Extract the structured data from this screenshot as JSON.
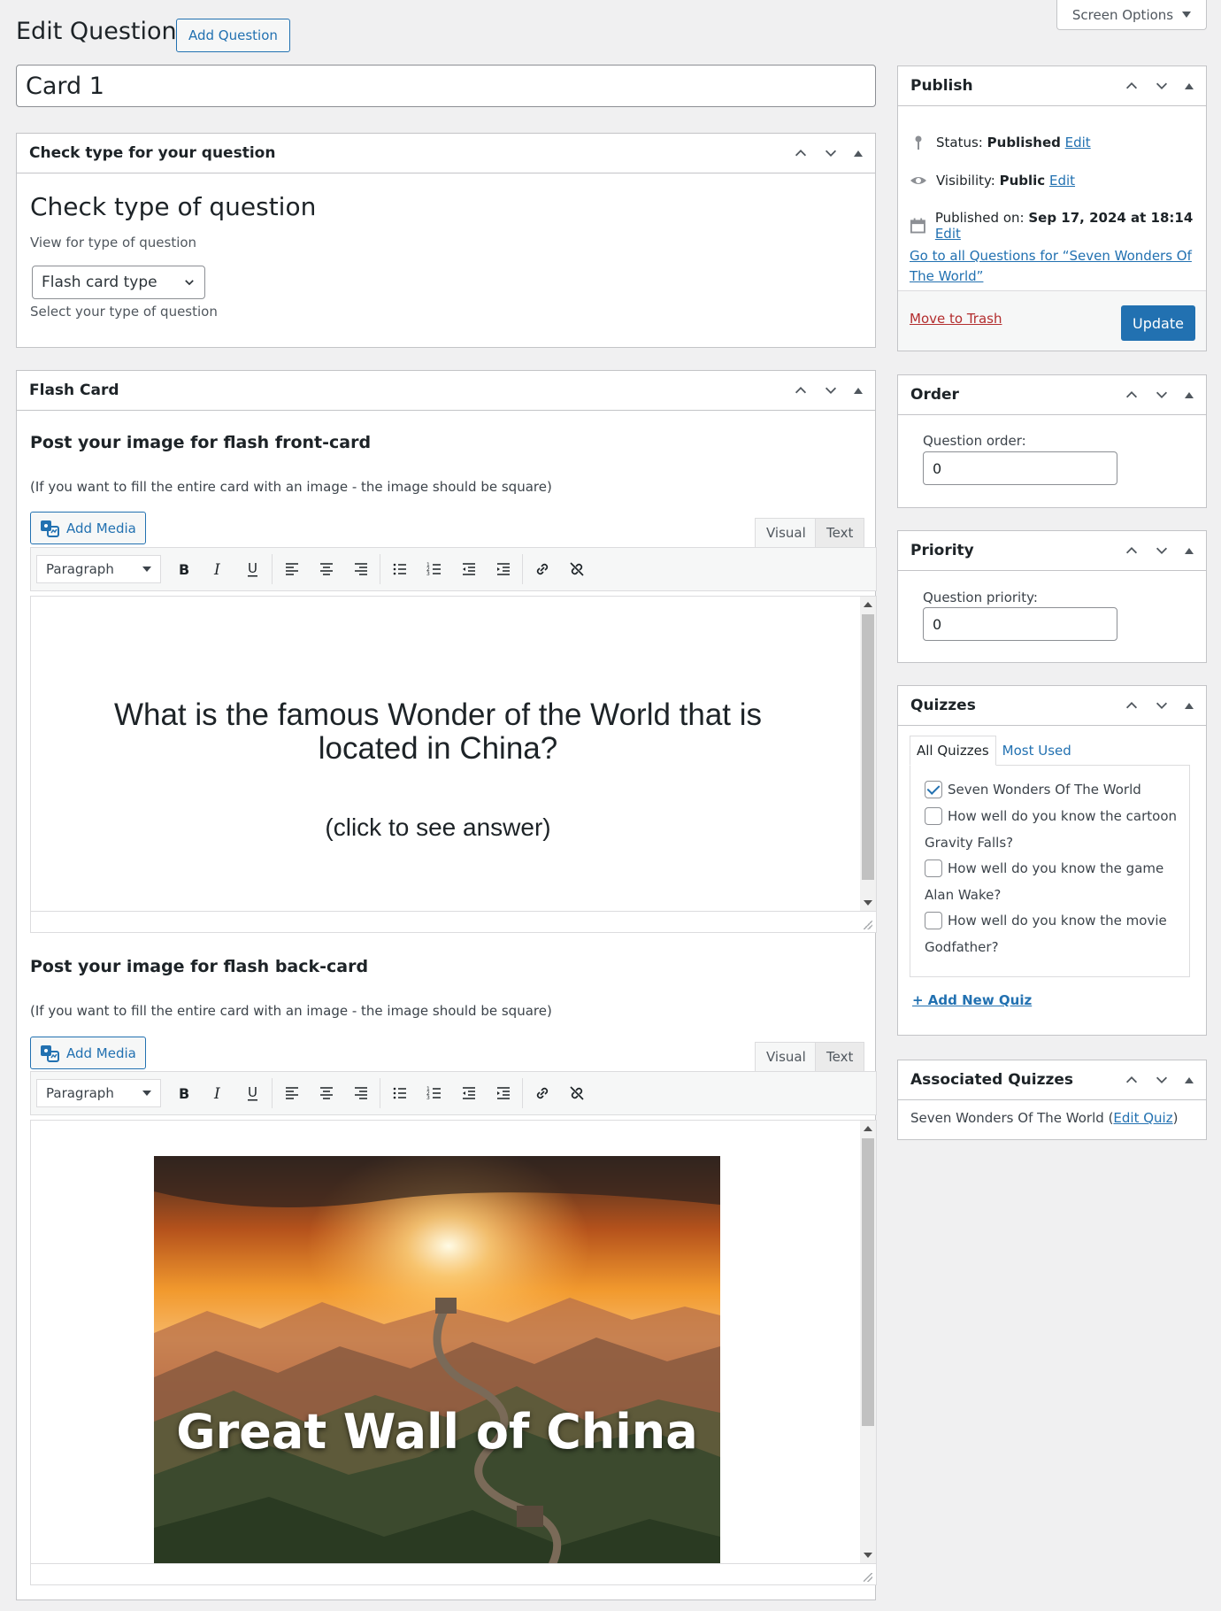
{
  "header": {
    "screen_options": "Screen Options",
    "page_title": "Edit Question",
    "add_question": "Add Question",
    "post_title": "Card 1"
  },
  "check_type": {
    "box_title": "Check type for your question",
    "heading": "Check type of question",
    "subtitle": "View for type of question",
    "selected_type": "Flash card type",
    "description": "Select your type of question"
  },
  "flash_card": {
    "box_title": "Flash Card",
    "front": {
      "heading": "Post your image for flash front-card",
      "note": "(If you want to fill the entire card with an image - the image should be square)",
      "add_media": "Add Media",
      "tab_visual": "Visual",
      "tab_text": "Text",
      "format": "Paragraph",
      "content_line1": "What is the famous Wonder of the World that is located in China?",
      "content_line2": "(click to see answer)"
    },
    "back": {
      "heading": "Post your image for flash back-card",
      "note": "(If you want to fill the entire card with an image - the image should be square)",
      "add_media": "Add Media",
      "tab_visual": "Visual",
      "tab_text": "Text",
      "format": "Paragraph",
      "image_caption": "Great Wall of China"
    }
  },
  "publish": {
    "title": "Publish",
    "status_label": "Status:",
    "status_value": "Published",
    "visibility_label": "Visibility:",
    "visibility_value": "Public",
    "published_label": "Published on:",
    "published_value": "Sep 17, 2024 at 18:14",
    "edit": "Edit",
    "all_questions_link": "Go to all Questions for “Seven Wonders Of The World”",
    "trash": "Move to Trash",
    "update": "Update"
  },
  "order": {
    "title": "Order",
    "label": "Question order:",
    "value": "0"
  },
  "priority": {
    "title": "Priority",
    "label": "Question priority:",
    "value": "0"
  },
  "quizzes": {
    "title": "Quizzes",
    "tab_all": "All Quizzes",
    "tab_most_used": "Most Used",
    "items": [
      {
        "label": "Seven Wonders Of The World",
        "checked": true
      },
      {
        "label": "How well do you know the cartoon Gravity Falls?",
        "checked": false
      },
      {
        "label": "How well do you know the game Alan Wake?",
        "checked": false
      },
      {
        "label": "How well do you know the movie Godfather?",
        "checked": false
      }
    ],
    "add_new": "+ Add New Quiz"
  },
  "associated": {
    "title": "Associated Quizzes",
    "quiz_name": "Seven Wonders Of The World",
    "open_paren": "(",
    "edit_link": "Edit Quiz",
    "close_paren": ")"
  },
  "icons": {
    "collapse_up": "chevron-up-icon",
    "collapse_down": "chevron-down-icon",
    "toggle": "triangle-up-icon",
    "status": "pin-icon",
    "visibility": "eye-icon",
    "calendar": "calendar-icon",
    "media": "media-icon"
  },
  "colors": {
    "accent": "#2271b1",
    "trash": "#b32d2e",
    "background": "#f0f0f1"
  }
}
